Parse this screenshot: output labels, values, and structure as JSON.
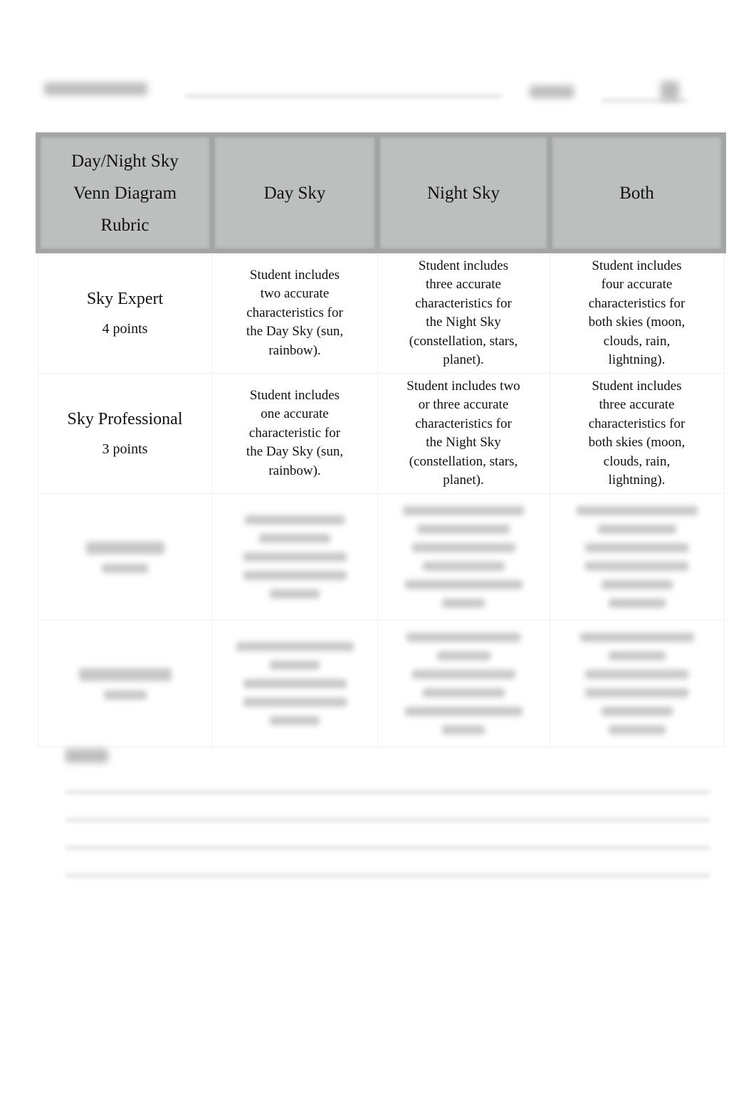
{
  "document": {
    "header_blurred": true,
    "rubric": {
      "columns": [
        "Day/Night Sky\nVenn Diagram\nRubric",
        "Day Sky",
        "Night Sky",
        "Both"
      ],
      "rows": [
        {
          "level": "Sky Expert",
          "points": "4 points",
          "day_sky": "Student includes\ntwo accurate\ncharacteristics for\nthe Day Sky (sun,\nrainbow).",
          "night_sky": "Student includes\nthree accurate\ncharacteristics for\nthe Night Sky\n(constellation, stars,\nplanet).",
          "both": "Student includes\nfour accurate\ncharacteristics for\nboth skies (moon,\nclouds, rain,\nlightning)."
        },
        {
          "level": "Sky Professional",
          "points": "3 points",
          "day_sky": "Student includes\none accurate\ncharacteristic for\nthe Day Sky (sun,\nrainbow).",
          "night_sky": "Student includes two\nor three accurate\ncharacteristics for\nthe Night Sky\n(constellation, stars,\nplanet).",
          "both": "Student includes\nthree accurate\ncharacteristics for\nboth skies (moon,\nclouds, rain,\nlightning)."
        }
      ],
      "blurred_rows": 2
    },
    "notes_blurred": true
  }
}
